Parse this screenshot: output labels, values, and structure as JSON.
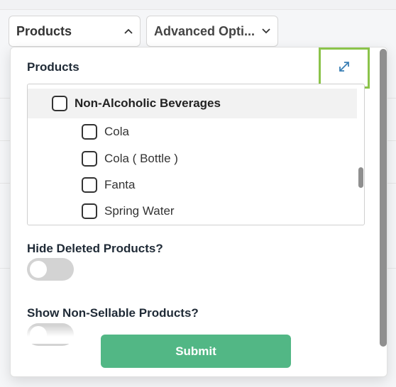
{
  "toolbar": {
    "products_dropdown": {
      "label": "Products",
      "icon": "chevron-up-icon"
    },
    "advanced_dropdown": {
      "label": "Advanced Opti...",
      "icon": "chevron-down-icon"
    }
  },
  "panel": {
    "title": "Products",
    "expand_icon": "expand-icon",
    "tree": {
      "group": {
        "label": "Non-Alcoholic Beverages",
        "checked": false
      },
      "items": [
        {
          "label": "Cola",
          "checked": false
        },
        {
          "label": "Cola ( Bottle )",
          "checked": false
        },
        {
          "label": "Fanta",
          "checked": false
        },
        {
          "label": "Spring Water",
          "checked": false
        }
      ]
    },
    "hide_deleted": {
      "label": "Hide Deleted Products?",
      "on": false
    },
    "show_non_sellable": {
      "label": "Show Non-Sellable Products?",
      "on": false
    },
    "submit_label": "Submit"
  },
  "colors": {
    "accent_green": "#52b785",
    "highlight_border": "#8bc34a",
    "expand_icon": "#3a7fb5"
  }
}
